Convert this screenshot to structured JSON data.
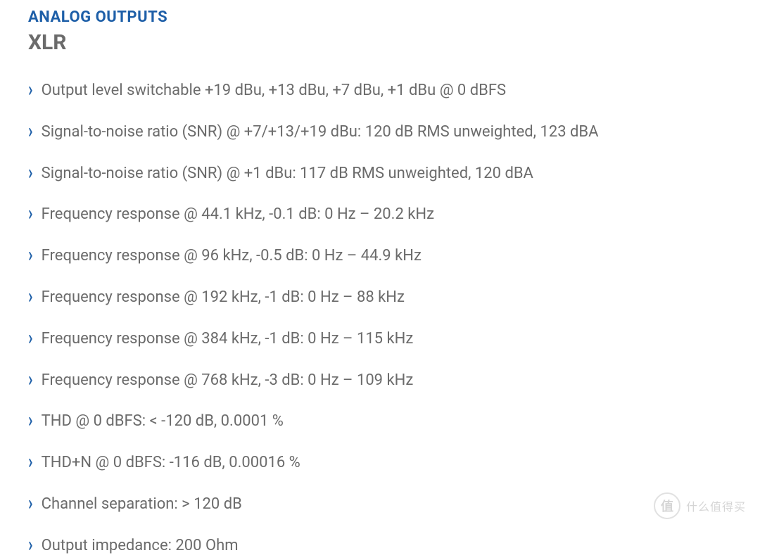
{
  "header": {
    "title": "ANALOG OUTPUTS",
    "subtitle": "XLR"
  },
  "specs": [
    "Output level switchable +19 dBu, +13 dBu, +7 dBu, +1 dBu @ 0 dBFS",
    "Signal-to-noise ratio (SNR) @ +7/+13/+19 dBu: 120 dB RMS unweighted, 123 dBA",
    "Signal-to-noise ratio (SNR) @ +1 dBu: 117 dB RMS unweighted, 120 dBA",
    "Frequency response @ 44.1 kHz, -0.1 dB: 0 Hz – 20.2 kHz",
    "Frequency response @ 96 kHz, -0.5 dB: 0 Hz – 44.9 kHz",
    "Frequency response @ 192 kHz, -1 dB: 0 Hz – 88 kHz",
    "Frequency response @ 384 kHz, -1 dB: 0 Hz – 115 kHz",
    "Frequency response @ 768 kHz, -3 dB: 0 Hz – 109 kHz",
    "THD @ 0 dBFS: < -120 dB, 0.0001 %",
    "THD+N @ 0 dBFS: -116 dB, 0.00016 %",
    "Channel separation: > 120 dB",
    "Output impedance: 200 Ohm"
  ],
  "watermark": {
    "badge": "值",
    "text": "什么值得买"
  }
}
